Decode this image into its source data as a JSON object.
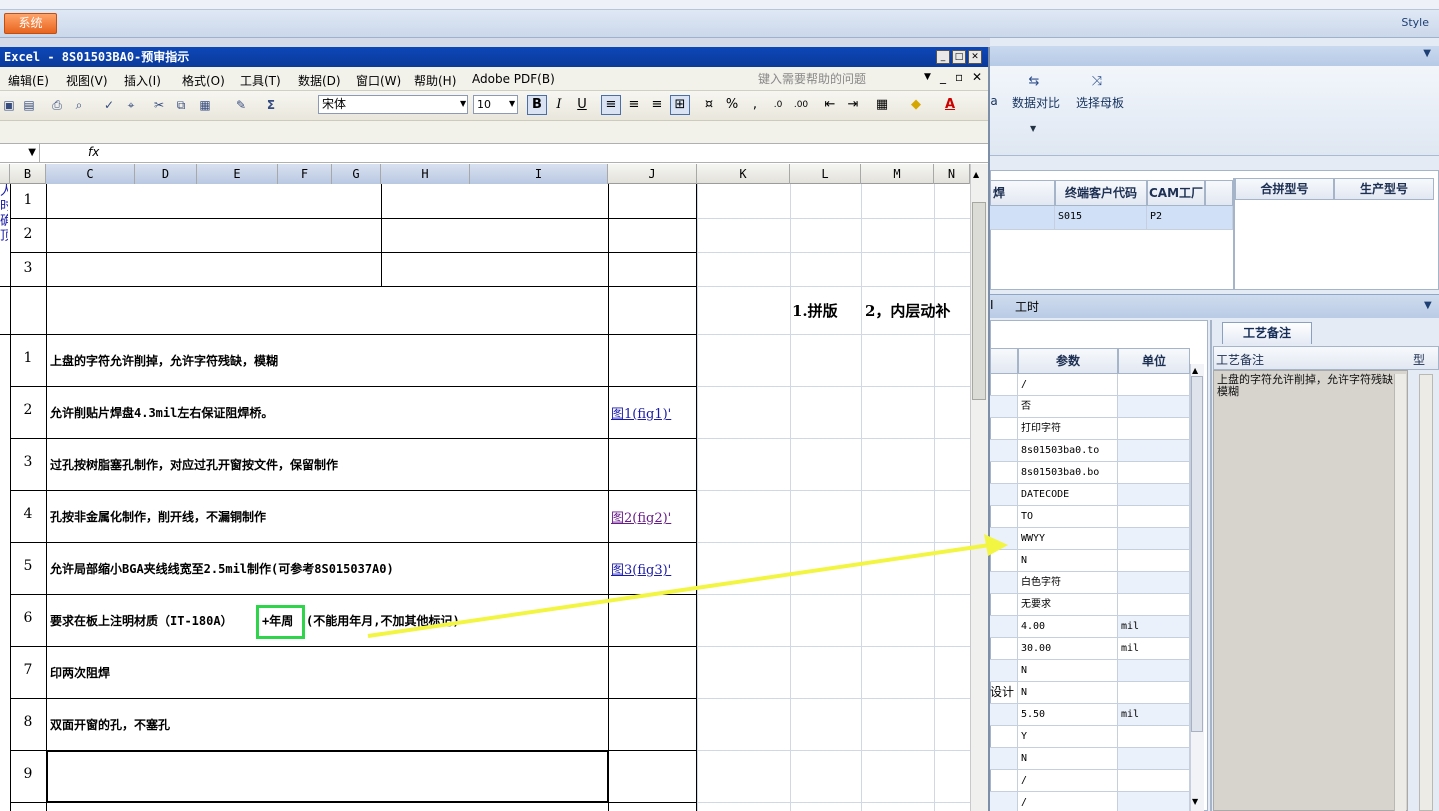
{
  "app": {
    "system_button": "系统",
    "style_menu": "Style",
    "ribbon": [
      {
        "label": "数据对比",
        "icon": "compare-icon"
      },
      {
        "label": "选择母板",
        "icon": "shuffle-icon"
      }
    ],
    "ribbon_partial_left": "a"
  },
  "excel": {
    "title": "Excel - 8S01503BA0-预审指示",
    "menu": [
      "编辑(E)",
      "视图(V)",
      "插入(I)",
      "格式(O)",
      "工具(T)",
      "数据(D)",
      "窗口(W)",
      "帮助(H)",
      "Adobe PDF(B)"
    ],
    "help_placeholder": "键入需要帮助的问题",
    "font_name": "宋体",
    "font_size": "10",
    "format_buttons": {
      "bold": "B",
      "italic": "I",
      "underline": "U",
      "percent": "%",
      "comma": ",",
      "font_color": "A",
      "sum": "Σ"
    },
    "fx": "fx",
    "columns": [
      "B",
      "C",
      "D",
      "E",
      "F",
      "G",
      "H",
      "I",
      "J",
      "K",
      "L",
      "M",
      "N"
    ],
    "left_partial_text": [
      "人",
      "时",
      "确",
      "顶"
    ],
    "rows_top": [
      "1",
      "2",
      "3"
    ],
    "note_row": {
      "text1": "1.拼版",
      "text2": "2，内层动补"
    },
    "rows": [
      {
        "n": "1",
        "text": "上盘的字符允许削掉，允许字符残缺，模糊",
        "link": ""
      },
      {
        "n": "2",
        "text": "允许削贴片焊盘4.3mil左右保证阻焊桥。",
        "link": "图1(fig1)'"
      },
      {
        "n": "3",
        "text": "过孔按树脂塞孔制作，对应过孔开窗按文件，保留制作",
        "link": ""
      },
      {
        "n": "4",
        "text": "孔按非金属化制作，削开线，不漏铜制作",
        "link": "图2(fig2)'"
      },
      {
        "n": "5",
        "text": "允许局部缩小BGA夹线线宽至2.5mil制作(可参考8S015037A0)",
        "link": "图3(fig3)'"
      },
      {
        "n": "6",
        "text": "要求在板上注明材质（IT-180A）",
        "text_hl": "+年周",
        "text_rest": "(不能用年月,不加其他标记)",
        "link": ""
      },
      {
        "n": "7",
        "text": "印两次阻焊",
        "link": ""
      },
      {
        "n": "8",
        "text": "双面开窗的孔，不塞孔",
        "link": ""
      },
      {
        "n": "9",
        "text": "",
        "link": ""
      }
    ]
  },
  "right_panel": {
    "top_table": {
      "headers": [
        "焊",
        "终端客户代码",
        "CAM工厂"
      ],
      "row": [
        "",
        "S015",
        "P2"
      ],
      "headers2": [
        "合拼型号",
        "生产型号"
      ]
    },
    "section_label_1": "I",
    "section_label_2": "工时",
    "param_table": {
      "headers": [
        "参数",
        "单位"
      ],
      "rows": [
        {
          "param": "/",
          "unit": ""
        },
        {
          "param": "否",
          "unit": ""
        },
        {
          "param": "打印字符",
          "unit": ""
        },
        {
          "param": "8s01503ba0.to",
          "unit": ""
        },
        {
          "param": "8s01503ba0.bo",
          "unit": ""
        },
        {
          "param": "DATECODE",
          "unit": ""
        },
        {
          "param": "TO",
          "unit": ""
        },
        {
          "param": "WWYY",
          "unit": ""
        },
        {
          "param": "N",
          "unit": ""
        },
        {
          "param": "白色字符",
          "unit": ""
        },
        {
          "param": "无要求",
          "unit": ""
        },
        {
          "param": "4.00",
          "unit": "mil"
        },
        {
          "param": "30.00",
          "unit": "mil"
        },
        {
          "param": "N",
          "unit": ""
        },
        {
          "param": "N",
          "unit": "",
          "left": "设计"
        },
        {
          "param": "5.50",
          "unit": "mil"
        },
        {
          "param": "Y",
          "unit": ""
        },
        {
          "param": "N",
          "unit": ""
        },
        {
          "param": "/",
          "unit": ""
        },
        {
          "param": "/",
          "unit": ""
        }
      ]
    },
    "remarks_tab": "工艺备注",
    "remarks_header": "工艺备注",
    "remarks_header2": "型",
    "remarks_text": "上盘的字符允许削掉，允许字符残缺，模糊"
  },
  "colors": {
    "highlight": "#2ed44a",
    "arrow": "#f2f542",
    "title_bar": "#0d47b8"
  }
}
